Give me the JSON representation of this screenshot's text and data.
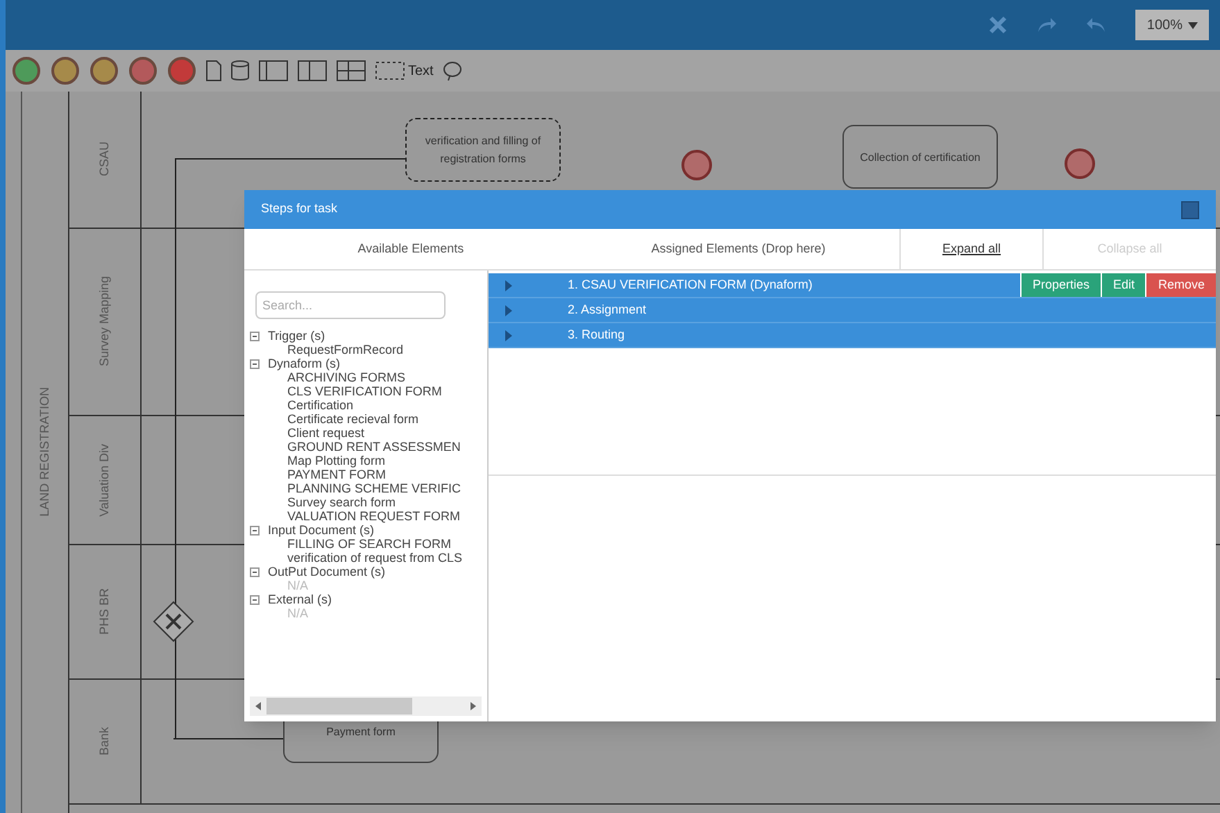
{
  "app_bar": {
    "zoom": "100%"
  },
  "toolbar": {
    "text_tool": "Text"
  },
  "diagram": {
    "pool": "LAND REGISTRATION",
    "lanes": [
      "CSAU",
      "Survey Mapping",
      "Valuation Div",
      "PHS BR",
      "Bank"
    ],
    "tasks": [
      {
        "label": "verification and filling of registration forms",
        "selected": true
      },
      {
        "label": "Collection of certification",
        "selected": false
      },
      {
        "label": "Payment form",
        "selected": false
      }
    ]
  },
  "dialog": {
    "title": "Steps for task",
    "columns": [
      "Available Elements",
      "Assigned Elements (Drop here)"
    ],
    "expand_all": {
      "label": "Expand all",
      "disabled": false
    },
    "collapse_all": {
      "label": "Collapse all",
      "disabled": true
    },
    "search": {
      "placeholder": "Search..."
    },
    "tree": [
      {
        "label": "Trigger (s)",
        "expanded": true,
        "children": [
          {
            "label": "RequestFormRecord",
            "disabled": false
          }
        ]
      },
      {
        "label": "Dynaform (s)",
        "expanded": true,
        "children": [
          {
            "label": "ARCHIVING FORMS",
            "disabled": false
          },
          {
            "label": "CLS VERIFICATION FORM",
            "disabled": false
          },
          {
            "label": "Certification",
            "disabled": false
          },
          {
            "label": "Certificate recieval form",
            "disabled": false
          },
          {
            "label": "Client request",
            "disabled": false
          },
          {
            "label": "GROUND RENT ASSESSMEN",
            "disabled": false
          },
          {
            "label": "Map Plotting form",
            "disabled": false
          },
          {
            "label": "PAYMENT FORM",
            "disabled": false
          },
          {
            "label": "PLANNING SCHEME VERIFIC",
            "disabled": false
          },
          {
            "label": "Survey search form",
            "disabled": false
          },
          {
            "label": "VALUATION REQUEST FORM",
            "disabled": false
          }
        ]
      },
      {
        "label": "Input Document (s)",
        "expanded": true,
        "children": [
          {
            "label": "FILLING OF SEARCH FORM",
            "disabled": false
          },
          {
            "label": "verification of request from CLS",
            "disabled": false
          }
        ]
      },
      {
        "label": "OutPut Document (s)",
        "expanded": true,
        "children": [
          {
            "label": "N/A",
            "disabled": true
          }
        ]
      },
      {
        "label": "External (s)",
        "expanded": true,
        "children": [
          {
            "label": "N/A",
            "disabled": true
          }
        ]
      }
    ],
    "steps": [
      {
        "label": "1. CSAU VERIFICATION FORM (Dynaform)",
        "actions": [
          {
            "label": "Properties",
            "kind": "properties"
          },
          {
            "label": "Edit",
            "kind": "edit"
          },
          {
            "label": "Remove",
            "kind": "remove"
          }
        ]
      },
      {
        "label": "2. Assignment"
      },
      {
        "label": "3. Routing"
      }
    ]
  }
}
